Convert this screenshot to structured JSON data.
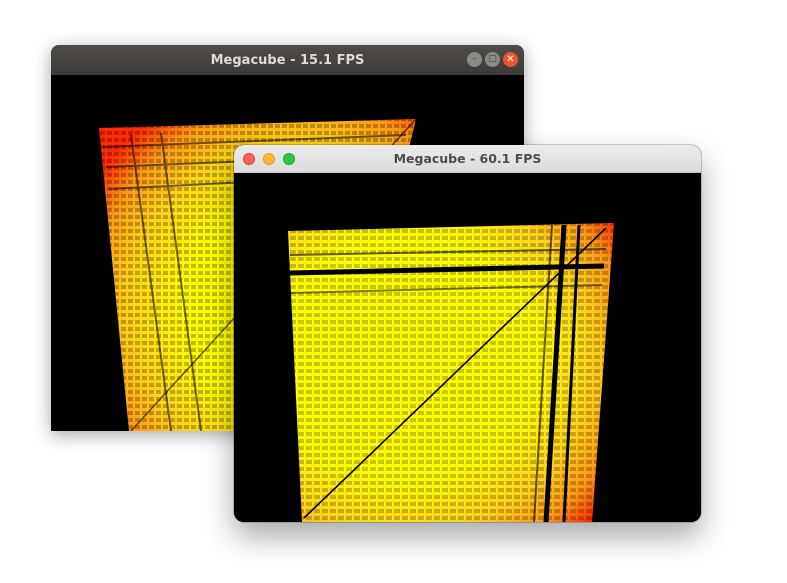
{
  "windows": {
    "back": {
      "title": "Megacube - 15.1 FPS",
      "fps": 15.1,
      "platform": "ubuntu",
      "controls": {
        "minimize_icon": "minimize-icon",
        "maximize_icon": "maximize-icon",
        "close_icon": "close-icon"
      }
    },
    "front": {
      "title": "Megacube - 60.1 FPS",
      "fps": 60.1,
      "platform": "macos",
      "controls": {
        "close_icon": "close-icon",
        "minimize_icon": "minimize-icon",
        "zoom_icon": "zoom-icon"
      }
    }
  },
  "colors": {
    "cube_core": "#ffff00",
    "cube_mid": "#ffa500",
    "cube_edge": "#ff2200",
    "background": "#000000"
  }
}
